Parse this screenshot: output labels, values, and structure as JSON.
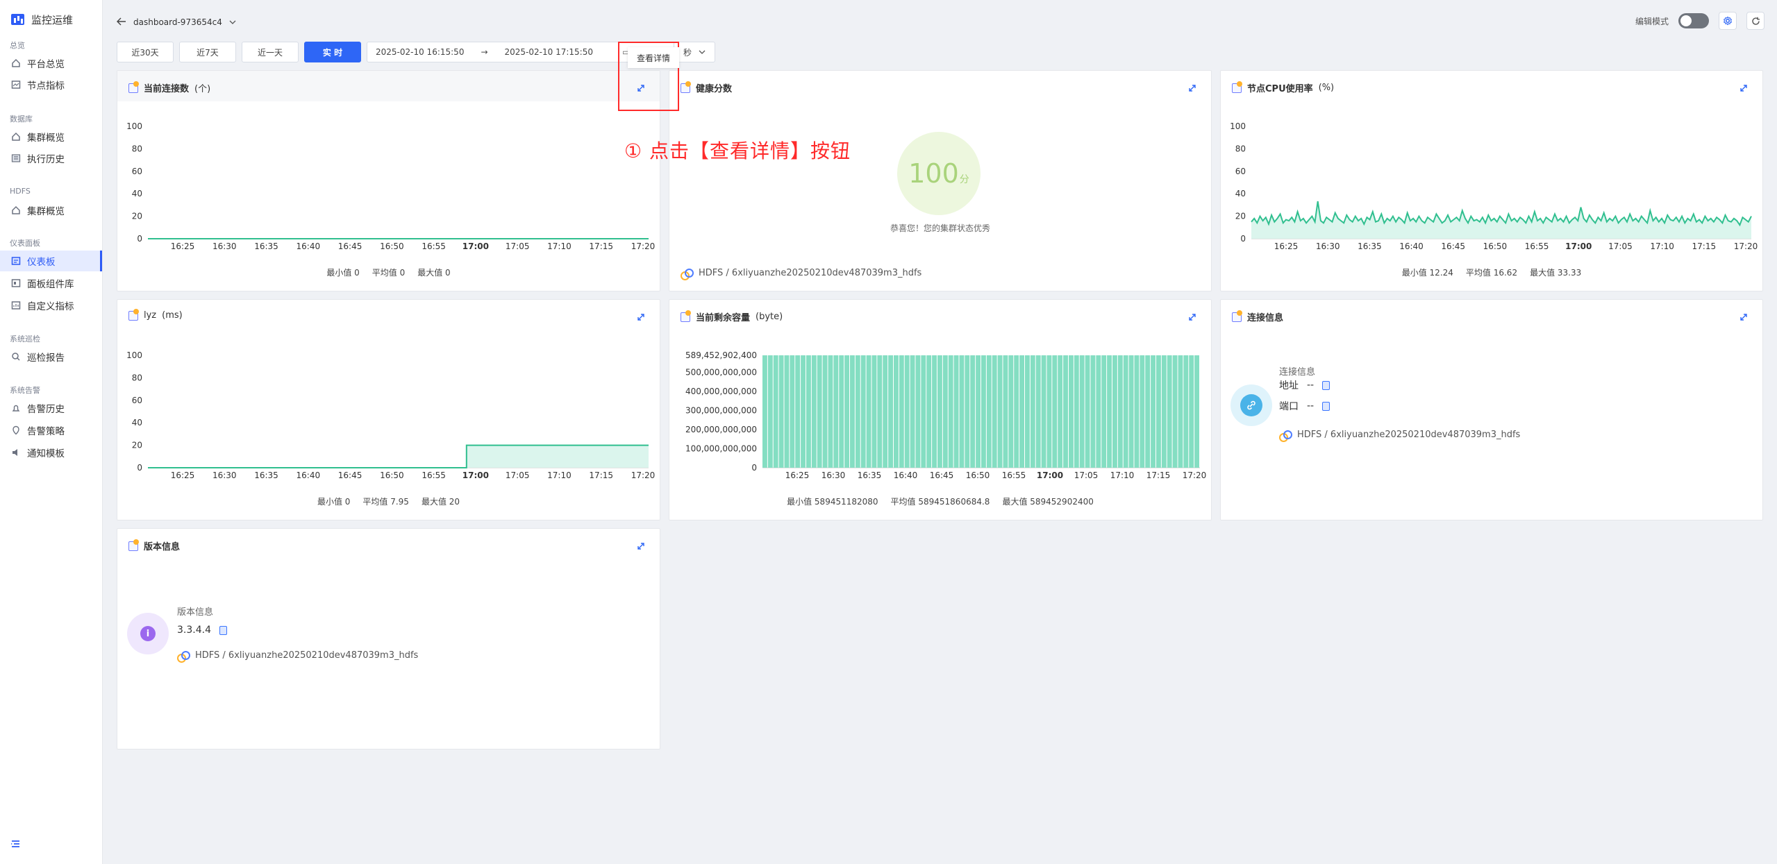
{
  "app": {
    "name": "监控运维"
  },
  "sidebar": {
    "groups": [
      {
        "label": "总览"
      },
      {
        "label": "数据库"
      },
      {
        "label": "HDFS"
      },
      {
        "label": "仪表面板"
      },
      {
        "label": "系统巡检"
      },
      {
        "label": "系统告警"
      }
    ],
    "items": [
      {
        "label": "平台总览",
        "icon": "home-icon"
      },
      {
        "label": "节点指标",
        "icon": "chart-icon"
      },
      {
        "label": "集群概览",
        "icon": "home-icon"
      },
      {
        "label": "执行历史",
        "icon": "list-icon"
      },
      {
        "label": "集群概览",
        "icon": "home-icon"
      },
      {
        "label": "仪表板",
        "icon": "dashboard-icon",
        "active": true
      },
      {
        "label": "面板组件库",
        "icon": "library-icon"
      },
      {
        "label": "自定义指标",
        "icon": "custom-icon"
      },
      {
        "label": "巡检报告",
        "icon": "search-report-icon"
      },
      {
        "label": "告警历史",
        "icon": "alert-history-icon"
      },
      {
        "label": "告警策略",
        "icon": "policy-icon"
      },
      {
        "label": "通知模板",
        "icon": "notify-icon"
      }
    ]
  },
  "header": {
    "dashboard_name": "dashboard-973654c4",
    "edit_mode_label": "编辑模式"
  },
  "filters": {
    "ranges": [
      "近30天",
      "近7天",
      "近一天",
      "实 时"
    ],
    "start": "2025-02-10 16:15:50",
    "end": "2025-02-10 17:15:50",
    "refresh_unit": "秒"
  },
  "tooltip": {
    "label": "查看详情"
  },
  "annotation": {
    "text": "① 点击【查看详情】按钮"
  },
  "time_axis": [
    "16:25",
    "16:30",
    "16:35",
    "16:40",
    "16:45",
    "16:50",
    "16:55",
    "17:00",
    "17:05",
    "17:10",
    "17:15",
    "17:20"
  ],
  "panels": {
    "connections": {
      "title": "当前连接数",
      "unit": "(个)",
      "min": "最小值 0",
      "avg": "平均值 0",
      "max": "最大值 0"
    },
    "health": {
      "title": "健康分数",
      "score": "100",
      "suffix": "分",
      "message": "恭喜您！您的集群状态优秀",
      "source": "HDFS / 6xliyuanzhe20250210dev487039m3_hdfs"
    },
    "cpu": {
      "title": "节点CPU使用率",
      "unit": "(%)",
      "min": "最小值 12.24",
      "avg": "平均值 16.62",
      "max": "最大值 33.33"
    },
    "lyz": {
      "title": "lyz",
      "unit": "(ms)",
      "min": "最小值 0",
      "avg": "平均值 7.95",
      "max": "最大值 20"
    },
    "capacity": {
      "title": "当前剩余容量",
      "unit": "(byte)",
      "min": "最小值 589451182080",
      "avg": "平均值 589451860684.8",
      "max": "最大值 589452902400"
    },
    "connection_info": {
      "title": "连接信息",
      "label": "连接信息",
      "address_label": "地址",
      "address_value": "--",
      "port_label": "端口",
      "port_value": "--",
      "source": "HDFS / 6xliyuanzhe20250210dev487039m3_hdfs"
    },
    "version_info": {
      "title": "版本信息",
      "label": "版本信息",
      "version": "3.3.4.4",
      "source": "HDFS / 6xliyuanzhe20250210dev487039m3_hdfs"
    }
  },
  "chart_data": [
    {
      "type": "line",
      "title": "当前连接数 (个)",
      "ylim": [
        0,
        100
      ],
      "y_ticks": [
        0,
        20,
        40,
        60,
        80,
        100
      ],
      "x": [
        "16:25",
        "16:30",
        "16:35",
        "16:40",
        "16:45",
        "16:50",
        "16:55",
        "17:00",
        "17:05",
        "17:10",
        "17:15",
        "17:20"
      ],
      "series": [
        {
          "values": [
            0,
            0,
            0,
            0,
            0,
            0,
            0,
            0,
            0,
            0,
            0,
            0
          ]
        }
      ]
    },
    {
      "type": "line",
      "title": "节点CPU使用率 (%)",
      "ylim": [
        0,
        100
      ],
      "y_ticks": [
        0,
        20,
        40,
        60,
        80,
        100
      ],
      "x": [
        "16:25",
        "16:30",
        "16:35",
        "16:40",
        "16:45",
        "16:50",
        "16:55",
        "17:00",
        "17:05",
        "17:10",
        "17:15",
        "17:20"
      ],
      "series": [
        {
          "values": [
            15,
            18,
            14,
            20,
            16,
            19,
            13,
            21,
            15,
            18,
            22,
            14,
            17,
            16,
            19,
            15,
            24,
            16,
            18,
            14,
            17,
            20,
            15,
            33.33,
            16,
            14,
            19,
            17,
            15,
            23,
            18,
            16,
            14,
            21,
            17,
            15,
            20,
            16,
            18,
            13,
            19,
            17,
            24,
            15,
            16,
            22,
            14,
            18,
            16,
            20,
            15,
            19,
            17,
            14,
            23,
            16,
            18,
            15,
            20,
            16,
            14,
            19,
            17,
            15,
            22,
            18,
            14,
            16,
            21,
            15,
            17,
            19,
            16,
            25,
            18,
            14,
            20,
            16,
            17,
            15,
            19,
            14,
            21,
            16,
            18,
            15,
            20,
            17,
            14,
            22,
            16,
            18,
            15,
            19,
            17,
            14,
            20,
            15,
            24,
            16,
            18,
            14,
            19,
            17,
            15,
            22,
            16,
            18,
            15,
            20,
            14,
            17,
            19,
            16,
            28,
            18,
            15,
            21,
            17,
            14,
            19,
            16,
            23,
            15,
            18,
            16,
            20,
            14,
            17,
            19,
            15,
            22,
            16,
            18,
            15,
            20,
            17,
            14,
            25,
            16,
            19,
            15,
            18,
            14,
            21,
            17,
            16,
            19,
            15,
            20,
            14,
            18,
            16,
            22,
            15,
            17,
            14,
            20,
            16,
            18,
            15,
            19,
            17,
            14,
            21,
            16,
            15,
            18,
            16,
            12.24,
            19,
            17,
            15,
            20
          ]
        }
      ]
    },
    {
      "type": "line",
      "title": "lyz (ms)",
      "ylim": [
        0,
        100
      ],
      "y_ticks": [
        0,
        20,
        40,
        60,
        80,
        100
      ],
      "x": [
        "16:25",
        "16:30",
        "16:35",
        "16:40",
        "16:45",
        "16:50",
        "16:55",
        "17:00",
        "17:05",
        "17:10",
        "17:15",
        "17:20"
      ],
      "series": [
        {
          "values": [
            0,
            0,
            0,
            0,
            0,
            0,
            0,
            20,
            20,
            20,
            20,
            20
          ]
        }
      ]
    },
    {
      "type": "bar",
      "title": "当前剩余容量 (byte)",
      "ylim": [
        0,
        589452902400
      ],
      "y_ticks": [
        "0",
        "100,000,000,000",
        "200,000,000,000",
        "300,000,000,000",
        "400,000,000,000",
        "500,000,000,000",
        "589,452,902,400"
      ],
      "x": [
        "16:25",
        "16:30",
        "16:35",
        "16:40",
        "16:45",
        "16:50",
        "16:55",
        "17:00",
        "17:05",
        "17:10",
        "17:15",
        "17:20"
      ],
      "series": [
        {
          "values": [
            589452902400,
            589452902400,
            589452902400,
            589452902400,
            589452902400,
            589452902400,
            589452902400,
            589452902400,
            589452902400,
            589452902400,
            589452902400,
            589452902400
          ]
        }
      ]
    }
  ],
  "colors": {
    "primary": "#2e66f6",
    "line": "#30bf8f",
    "bar": "#84dec2",
    "annotation": "#ff2a2a",
    "health": "#a9d37b"
  }
}
